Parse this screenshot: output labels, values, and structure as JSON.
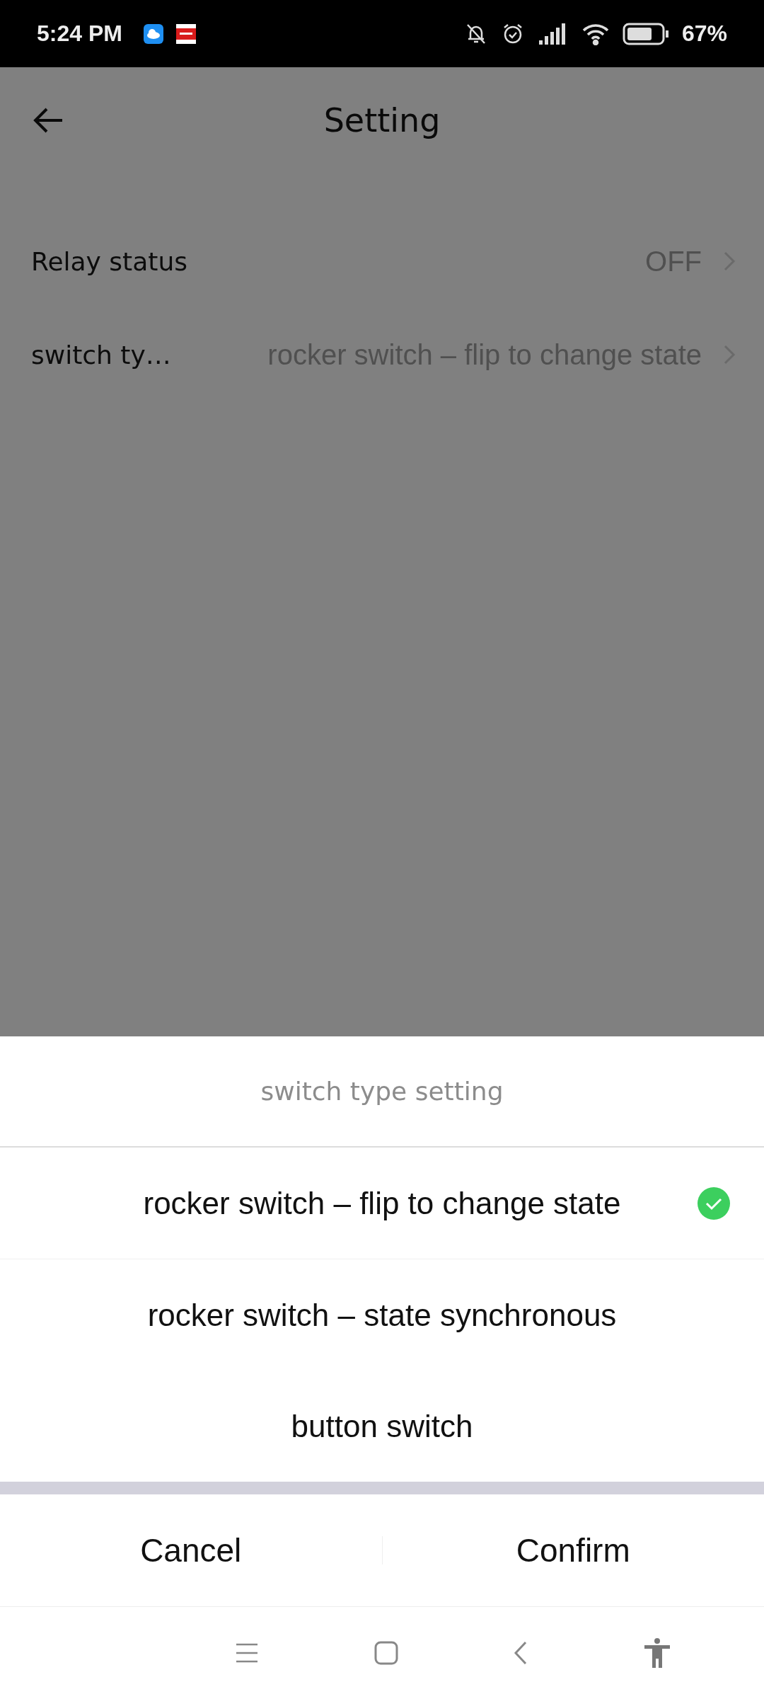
{
  "status_bar": {
    "time": "5:24 PM",
    "battery": "67%"
  },
  "header": {
    "title": "Setting"
  },
  "settings": [
    {
      "label": "Relay status",
      "value": "OFF"
    },
    {
      "label": "switch ty…",
      "value": "rocker switch – flip to change state"
    }
  ],
  "sheet": {
    "title": "switch type setting",
    "options": [
      {
        "label": "rocker switch – flip to change state",
        "selected": true
      },
      {
        "label": "rocker switch – state synchronous",
        "selected": false
      },
      {
        "label": "button switch",
        "selected": false
      }
    ],
    "buttons": [
      {
        "label": "Cancel"
      },
      {
        "label": "Confirm"
      }
    ]
  }
}
